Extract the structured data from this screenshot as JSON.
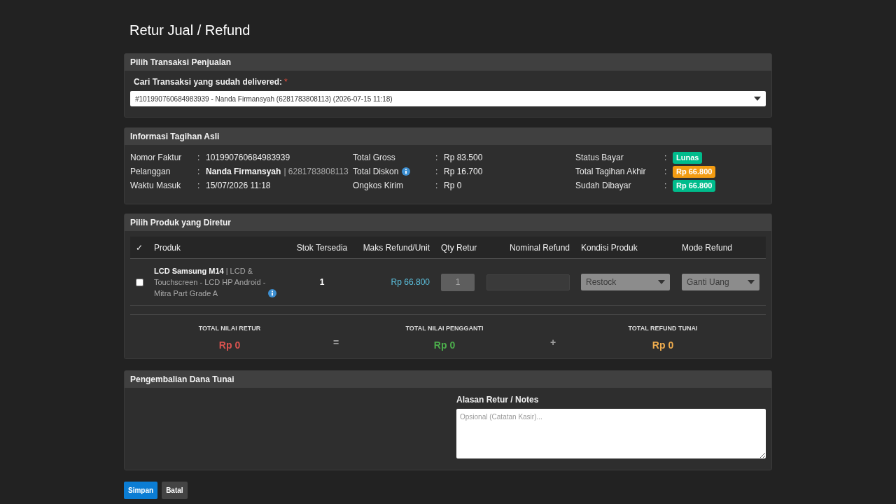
{
  "page": {
    "title": "Retur Jual / Refund"
  },
  "transaction_panel": {
    "title": "Pilih Transaksi Penjualan",
    "field_label": "Cari Transaksi yang sudah delivered:",
    "required_mark": "*",
    "selected_value": "#101990760684983939 - Nanda Firmansyah (6281783808113) (2026-07-15 11:18)"
  },
  "invoice_panel": {
    "title": "Informasi Tagihan Asli",
    "columns": [
      [
        {
          "kind": "text",
          "label": "Nomor Faktur",
          "separator": ":",
          "value": "101990760684983939"
        },
        {
          "kind": "customer",
          "label": "Pelanggan",
          "separator": ":",
          "name": "Nanda Firmansyah",
          "secondary": "| 6281783808113"
        },
        {
          "kind": "text",
          "label": "Waktu Masuk",
          "separator": ":",
          "value": "15/07/2026 11:18"
        }
      ],
      [
        {
          "kind": "text",
          "label": "Total Gross",
          "separator": ":",
          "value": "Rp 83.500"
        },
        {
          "kind": "text",
          "label": "Total Diskon",
          "separator": ":",
          "value": "Rp 16.700",
          "info": true
        },
        {
          "kind": "text",
          "label": "Ongkos Kirim",
          "separator": ":",
          "value": "Rp 0"
        }
      ],
      [
        {
          "kind": "badge",
          "label": "Status Bayar",
          "separator": ":",
          "value": "Lunas",
          "color": "#00bc8c"
        },
        {
          "kind": "badge",
          "label": "Total Tagihan Akhir",
          "separator": ":",
          "value": "Rp 66.800",
          "color": "#f39c12"
        },
        {
          "kind": "badge",
          "label": "Sudah Dibayar",
          "separator": ":",
          "value": "Rp 66.800",
          "color": "#00bc8c"
        }
      ]
    ]
  },
  "products_panel": {
    "title": "Pilih Produk yang Diretur",
    "columns": [
      "✓",
      "Produk",
      "Stok Tersedia",
      "Maks Refund/Unit",
      "Qty Retur",
      "Nominal Refund",
      "Kondisi Produk",
      "Mode Refund"
    ],
    "rows": [
      {
        "selected": false,
        "disabled": true,
        "name": "LCD Samsung M14",
        "detail": "| LCD & Touchscreen - LCD HP Android - Mitra Part Grade A",
        "info": true,
        "stock": "1",
        "max_refund": "Rp 66.800",
        "qty": "1",
        "condition": "Restock",
        "mode": "Ganti Uang"
      }
    ],
    "totals": [
      {
        "kind": "total",
        "label": "TOTAL NILAI RETUR",
        "value": "Rp 0",
        "color": "#d9534f"
      },
      {
        "kind": "operator",
        "symbol": "="
      },
      {
        "kind": "total",
        "label": "TOTAL NILAI PENGGANTI",
        "value": "Rp 0",
        "color": "#4cae4c"
      },
      {
        "kind": "operator",
        "symbol": "+"
      },
      {
        "kind": "total",
        "label": "TOTAL REFUND TUNAI",
        "value": "Rp 0",
        "color": "#f0ad4e"
      }
    ]
  },
  "cash_panel": {
    "title": "Pengembalian Dana Tunai",
    "notes_label": "Alasan Retur / Notes",
    "notes_placeholder": "Opsional (Catatan Kasir)..."
  },
  "buttons": [
    {
      "kind": "primary",
      "label": "Simpan"
    },
    {
      "kind": "secondary",
      "label": "Batal"
    }
  ]
}
